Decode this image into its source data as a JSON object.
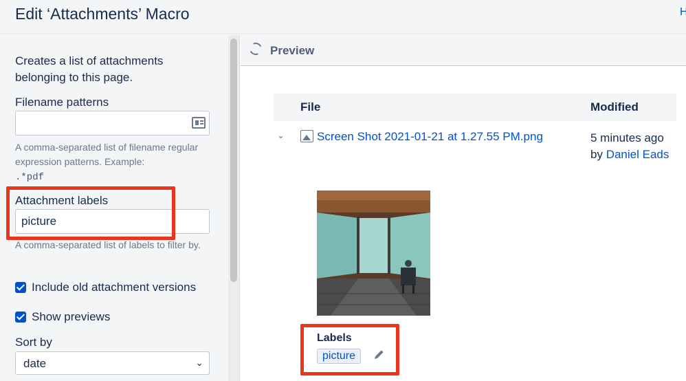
{
  "header": {
    "title": "Edit ‘Attachments’ Macro",
    "help_link": "H"
  },
  "form": {
    "description": "Creates a list of attachments belonging to this page.",
    "filename_patterns": {
      "label": "Filename patterns",
      "value": "",
      "help": "A comma-separated list of filename regular expression patterns. Example:",
      "help_example": ".*pdf"
    },
    "attachment_labels": {
      "label": "Attachment labels",
      "value": "picture",
      "help": "A comma-separated list of labels to filter by."
    },
    "include_old_versions": {
      "label": "Include old attachment versions",
      "checked": true
    },
    "show_previews": {
      "label": "Show previews",
      "checked": true
    },
    "sort_by": {
      "label": "Sort by",
      "value": "date"
    }
  },
  "preview": {
    "title": "Preview",
    "columns": {
      "file": "File",
      "modified": "Modified"
    },
    "rows": [
      {
        "file_name": "Screen Shot 2021-01-21 at 1.27.55 PM.png",
        "modified_time": "5 minutes ago",
        "modified_by_prefix": "by",
        "modified_by_name": "Daniel Eads",
        "labels_title": "Labels",
        "labels": [
          "picture"
        ]
      }
    ]
  },
  "colors": {
    "link": "#0052cc",
    "highlight": "#e8361e",
    "checkbox": "#0052cc",
    "panel_background": "#f4f5f7"
  }
}
